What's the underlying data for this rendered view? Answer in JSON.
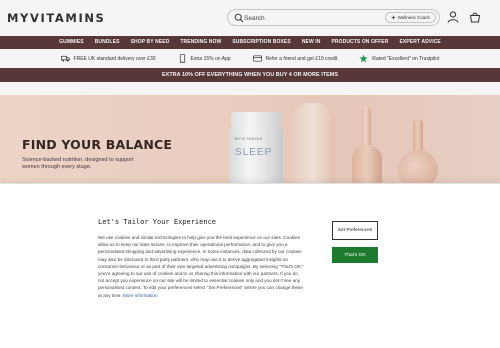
{
  "header": {
    "logo": "MYVITAMINS",
    "search_placeholder": "Search",
    "coach_label": "Wellness Coach",
    "icons": [
      "search-icon",
      "sparkle-icon",
      "account-icon",
      "basket-icon"
    ]
  },
  "nav": {
    "items": [
      "GUMMIES",
      "BUNDLES",
      "SHOP BY NEED",
      "TRENDING NOW",
      "SUBSCRIPTION BOXES",
      "NEW IN",
      "PRODUCTS ON OFFER",
      "EXPERT ADVICE"
    ]
  },
  "usp": {
    "items": [
      {
        "icon": "truck-icon",
        "text": "FREE UK standard delivery over £30"
      },
      {
        "icon": "phone-icon",
        "text": "Extra 15% on App"
      },
      {
        "icon": "card-icon",
        "text": "Refer a friend and get £10 credit"
      },
      {
        "icon": "star-icon",
        "text": "Rated \"Excellent\" on Trustpilot"
      }
    ]
  },
  "promo": {
    "text": "EXTRA 10% OFF EVERYTHING WHEN YOU BUY 4 OR MORE ITEMS"
  },
  "hero": {
    "title": "FIND YOUR BALANCE",
    "subtitle": "Science-backed nutrition, designed to support women through every stage.",
    "jar_brand": "MYVITAMINS",
    "jar_label": "SLEEP"
  },
  "cookie": {
    "title": "Let's Tailor Your Experience",
    "body": "We use cookies and similar technologies to help give you the best experience on our sites. Cookies allow us to keep our sites secure, to improve their operational performance, and to give you a personalised shopping and advertising experience. In some instances, data collected by our cookies may also be disclosed to third party partners, who may use it to derive aggregated insights on consumer behaviour or as part of their own targeted advertising campaigns. By selecting \"That's OK\" you're agreeing to our use of cookies and to us sharing this information with our partners. If you do not accept you experience on our site will be limited to essential cookies only and you don't see any personalised content. To edit your preferences select \"Set Preferences\" where you can change these at any time.",
    "more_info": "More information",
    "prefs_button": "Set Preferences",
    "ok_button": "That's OK"
  },
  "colors": {
    "brand": "#5b3a3a",
    "accept": "#1e7a2c",
    "link": "#2a5db0",
    "trustpilot": "#1e9e4f"
  }
}
